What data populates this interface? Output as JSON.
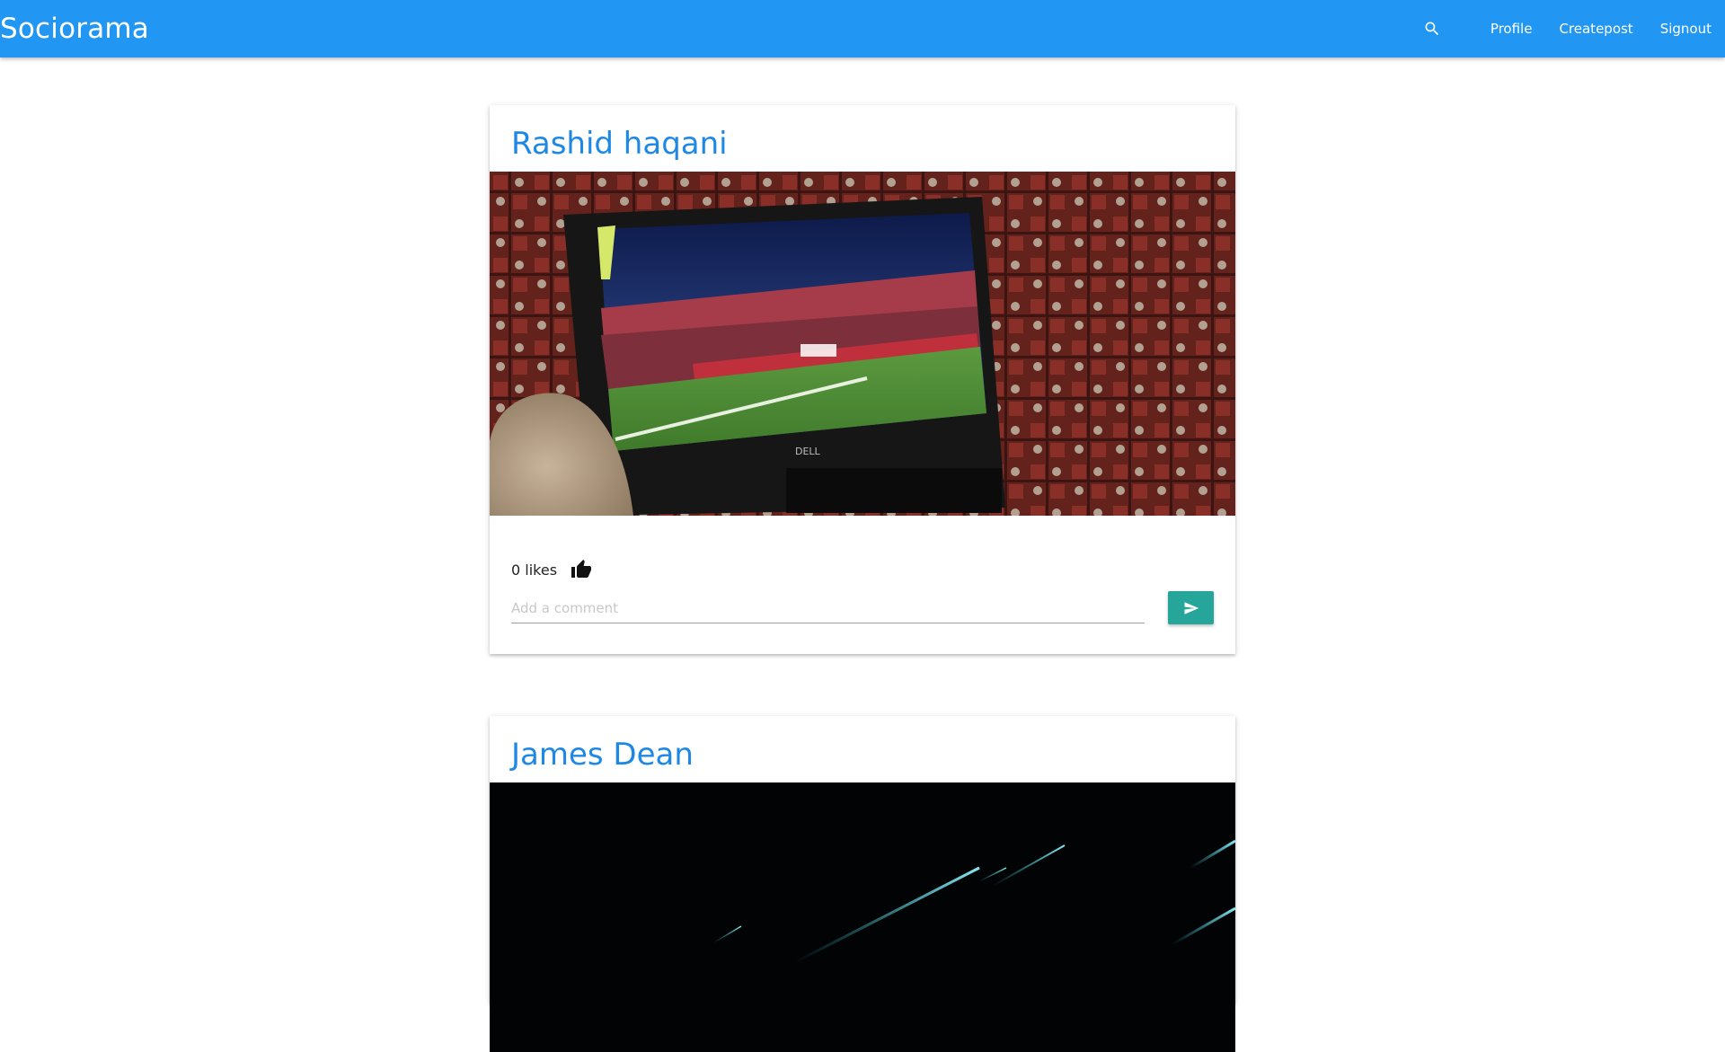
{
  "navbar": {
    "brand": "Sociorama",
    "search_icon": "search-icon",
    "links": [
      "Profile",
      "Createpost",
      "Signout"
    ]
  },
  "posts": [
    {
      "author": "Rashid haqani",
      "likes_text": "0 likes",
      "like_icon": "thumb-up-icon",
      "comment_placeholder": "Add a comment",
      "send_icon": "send-icon"
    },
    {
      "author": "James Dean"
    }
  ],
  "colors": {
    "navbar": "#2196f3",
    "author": "#1e88e5",
    "send_button": "#26a69a"
  }
}
